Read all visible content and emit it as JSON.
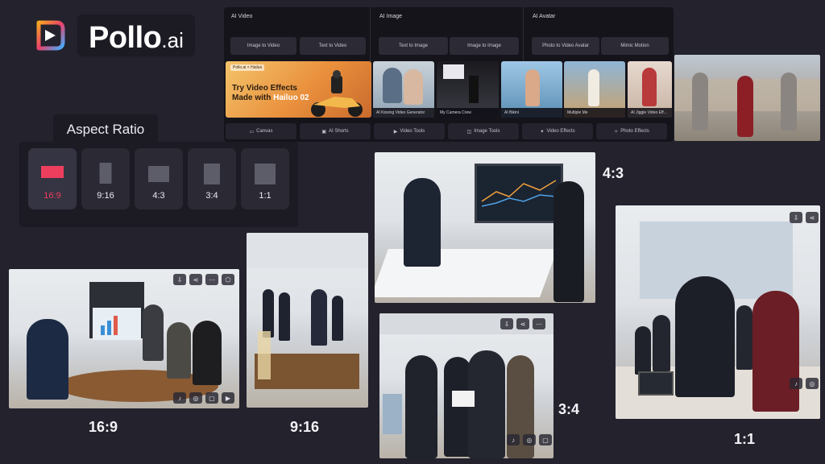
{
  "brand": {
    "name": "Pollo",
    "suffix": ".ai"
  },
  "menu": {
    "columns": [
      {
        "title": "AI Video",
        "buttons": [
          "Image to Video",
          "Text to Video"
        ]
      },
      {
        "title": "AI Image",
        "buttons": [
          "Text to Image",
          "Image to Image"
        ]
      },
      {
        "title": "AI Avatar",
        "buttons": [
          "Photo to Video Avatar",
          "Mimic Motion"
        ]
      }
    ],
    "promo": {
      "brand_tag": "Pollo.ai × Hailuo",
      "line1": "Try Video Effects",
      "line2": "Made with",
      "highlight": "Hailuo 02"
    },
    "thumbs": [
      "AI Kissing Video Generator",
      "My Camera Crew",
      "AI Bikini",
      "Multiple Me",
      "AI Jiggle Video Eff..."
    ],
    "tools": [
      "Canvas",
      "AI Shorts",
      "Video Tools",
      "Image Tools",
      "Video Effects",
      "Photo Effects"
    ]
  },
  "aspect": {
    "title": "Aspect Ratio",
    "options": [
      "16:9",
      "9:16",
      "4:3",
      "3:4",
      "1:1"
    ],
    "selected": "16:9"
  },
  "results": {
    "r169": "16:9",
    "r916": "9:16",
    "r43": "4:3",
    "r34": "3:4",
    "r11": "1:1"
  },
  "colors": {
    "accent": "#ee3e5e",
    "background": "#23222d",
    "panel": "#15141b"
  },
  "icons": {
    "download": "download-icon",
    "share": "share-icon",
    "more": "more-icon",
    "bookmark": "bookmark-icon",
    "tiktok": "tiktok-icon",
    "instagram": "instagram-icon",
    "comment": "comment-icon",
    "youtube": "youtube-icon"
  }
}
